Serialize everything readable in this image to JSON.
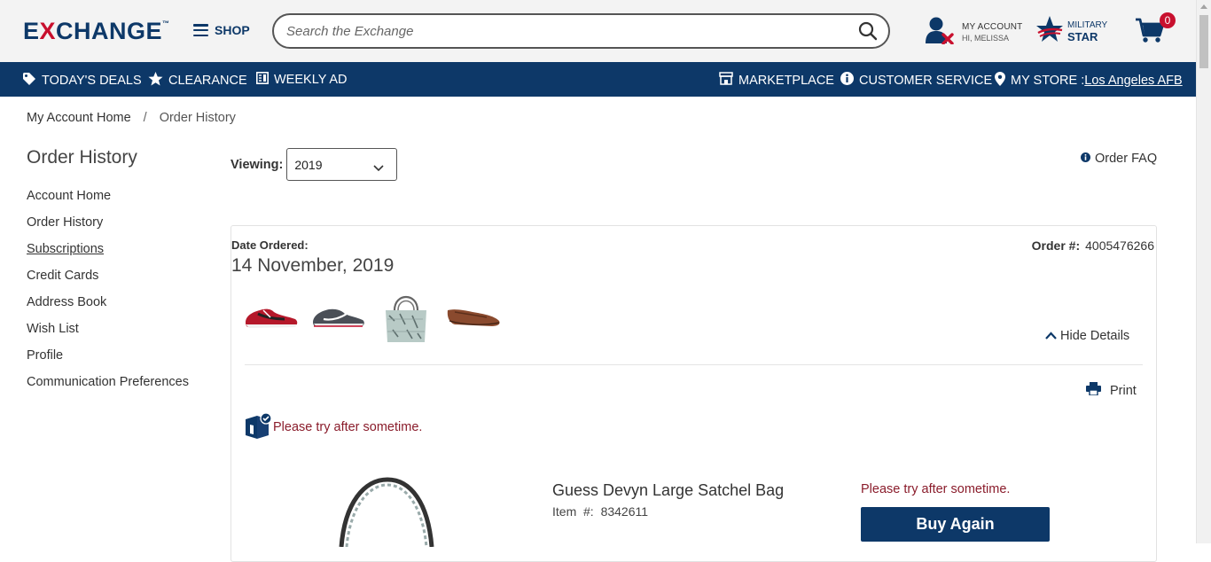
{
  "header": {
    "logo_text": "EXCHANGE",
    "shop_label": "SHOP",
    "search_placeholder": "Search the Exchange",
    "account_line1": "MY ACCOUNT",
    "account_line2": "HI, MELISSA",
    "star_line1": "MILITARY",
    "star_line2": "STAR",
    "cart_count": "0"
  },
  "nav": {
    "deals": "TODAY'S DEALS",
    "clearance": "CLEARANCE",
    "weekly_ad": "WEEKLY AD",
    "marketplace": "MARKETPLACE",
    "customer_service": "CUSTOMER SERVICE",
    "my_store_label": "MY STORE : ",
    "my_store_value": "Los Angeles AFB"
  },
  "breadcrumb": {
    "home": "My Account Home",
    "sep": "/",
    "current": "Order History"
  },
  "sidebar": {
    "title": "Order History",
    "items": [
      {
        "label": "Account Home"
      },
      {
        "label": "Order History"
      },
      {
        "label": "Subscriptions"
      },
      {
        "label": "Credit Cards"
      },
      {
        "label": "Address Book"
      },
      {
        "label": "Wish List"
      },
      {
        "label": "Profile"
      },
      {
        "label": "Communication Preferences"
      }
    ]
  },
  "filter": {
    "viewing_label": "Viewing:",
    "selected_year": "2019",
    "faq_label": "Order FAQ"
  },
  "order": {
    "date_label": "Date Ordered:",
    "date_value": "14 November, 2019",
    "order_no_label": "Order #:",
    "order_no_value": "4005476266",
    "hide_details": "Hide Details",
    "print": "Print",
    "status_message": "Please try after sometime.",
    "product": {
      "name": "Guess Devyn Large Satchel Bag",
      "item_label": "Item  #:",
      "item_number": "8342611",
      "error": "Please try after sometime.",
      "buy_again": "Buy Again"
    }
  },
  "colors": {
    "brand_navy": "#0d3868",
    "brand_red": "#c8102e",
    "error_red": "#8a1c2b"
  }
}
